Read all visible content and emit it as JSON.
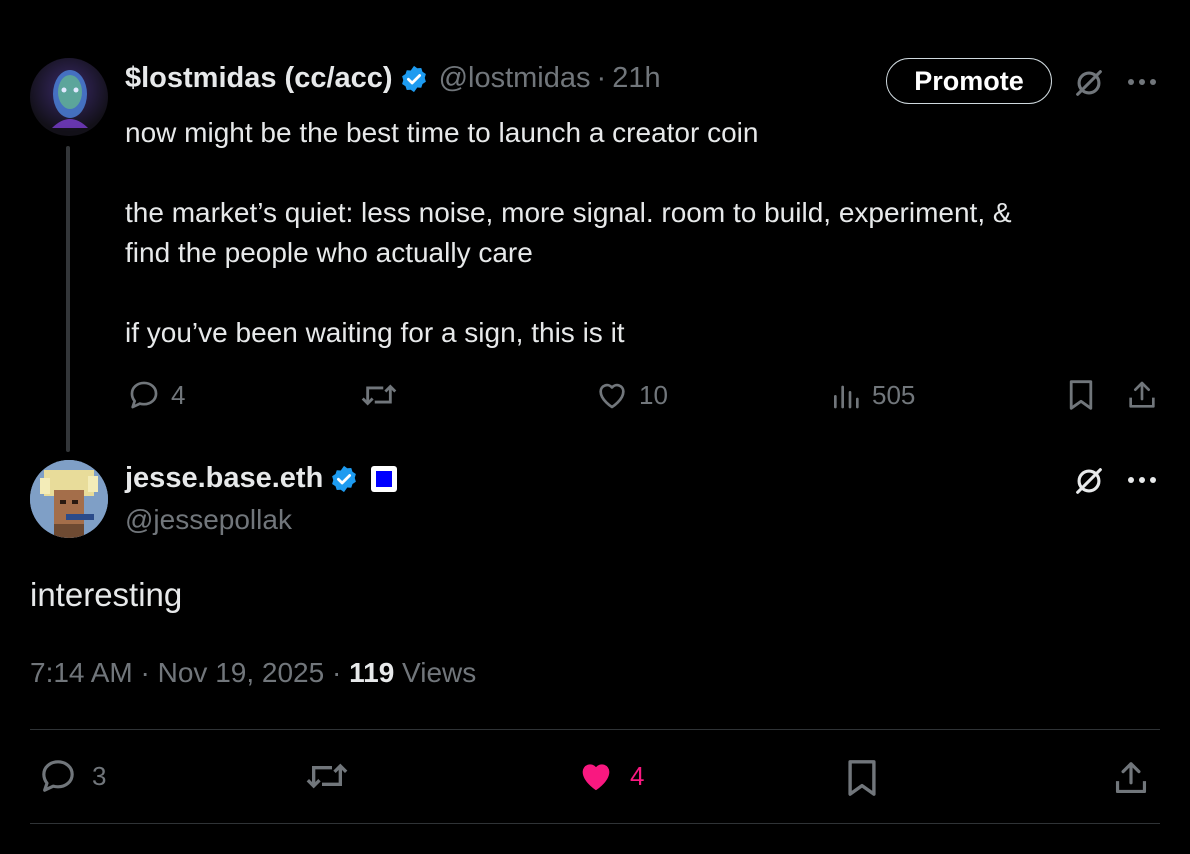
{
  "tweet1": {
    "display_name": "$lostmidas (cc/acc)",
    "handle": "@lostmidas",
    "separator": "·",
    "time": "21h",
    "promote_label": "Promote",
    "lines": [
      "now might be the best time to launch a creator coin",
      "",
      "the market’s quiet: less noise, more signal. room to build, experiment, &",
      "find the people who actually care",
      "",
      "if you’ve been waiting for a sign, this is it"
    ],
    "replies": "4",
    "likes": "10",
    "views": "505"
  },
  "tweet2": {
    "display_name": "jesse.base.eth",
    "handle": "@jessepollak",
    "text": "interesting",
    "time": "7:14 AM",
    "separator": "·",
    "date": "Nov 19, 2025",
    "view_count": "119",
    "views_label": "Views",
    "replies": "3",
    "likes": "4"
  },
  "colors": {
    "background": "#000000",
    "text": "#e7e9ea",
    "secondary": "#71767b",
    "verified": "#1d9bf0",
    "like_active": "#f91880",
    "divider": "#2f3336"
  },
  "icons": [
    "verified-badge-icon",
    "grok-icon",
    "more-icon",
    "reply-icon",
    "repost-icon",
    "like-icon",
    "views-icon",
    "bookmark-icon",
    "share-icon"
  ]
}
